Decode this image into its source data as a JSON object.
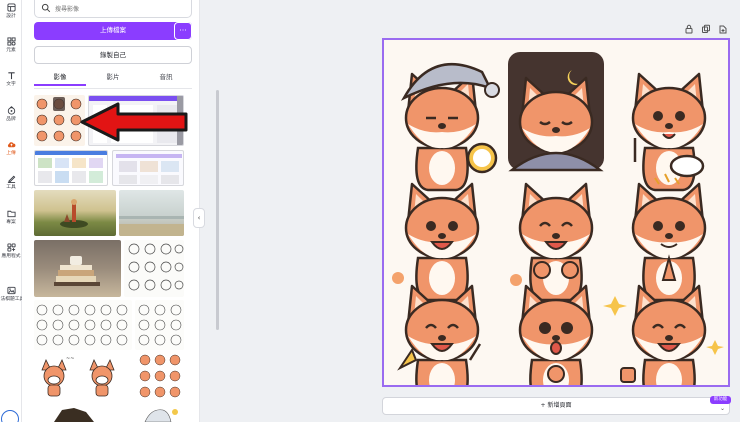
{
  "rail": {
    "items": [
      {
        "label": "設計",
        "icon": "layout-icon"
      },
      {
        "label": "元素",
        "icon": "shapes-icon"
      },
      {
        "label": "文字",
        "icon": "text-icon"
      },
      {
        "label": "品牌",
        "icon": "brand-icon"
      },
      {
        "label": "上傳",
        "icon": "upload-cloud-icon"
      },
      {
        "label": "工具",
        "icon": "draw-icon"
      },
      {
        "label": "專案",
        "icon": "folder-icon"
      },
      {
        "label": "應用程式",
        "icon": "apps-icon"
      },
      {
        "label": "法棋題工具",
        "icon": "image-tool-icon"
      }
    ]
  },
  "panel": {
    "search_placeholder": "搜尋影像",
    "upload_label": "上傳檔案",
    "more_label": "···",
    "record_label": "錄製自己",
    "tabs": [
      "影像",
      "影片",
      "音訊"
    ],
    "active_tab": 0
  },
  "canvas": {
    "add_page_label": "+ 新增頁面",
    "new_badge": "新功能",
    "stickers": [
      "sleepy-fox-nightcap",
      "sleeping-fox-night",
      "fox-eating",
      "fox-smile",
      "fox-clapping",
      "fox-praying",
      "fox-cheering",
      "fox-surprised",
      "fox-thumbs-up"
    ]
  },
  "colors": {
    "accent": "#8b3dff",
    "active_rail": "#e05a1c",
    "fox": "#f0956a",
    "outline": "#3a2a22"
  }
}
